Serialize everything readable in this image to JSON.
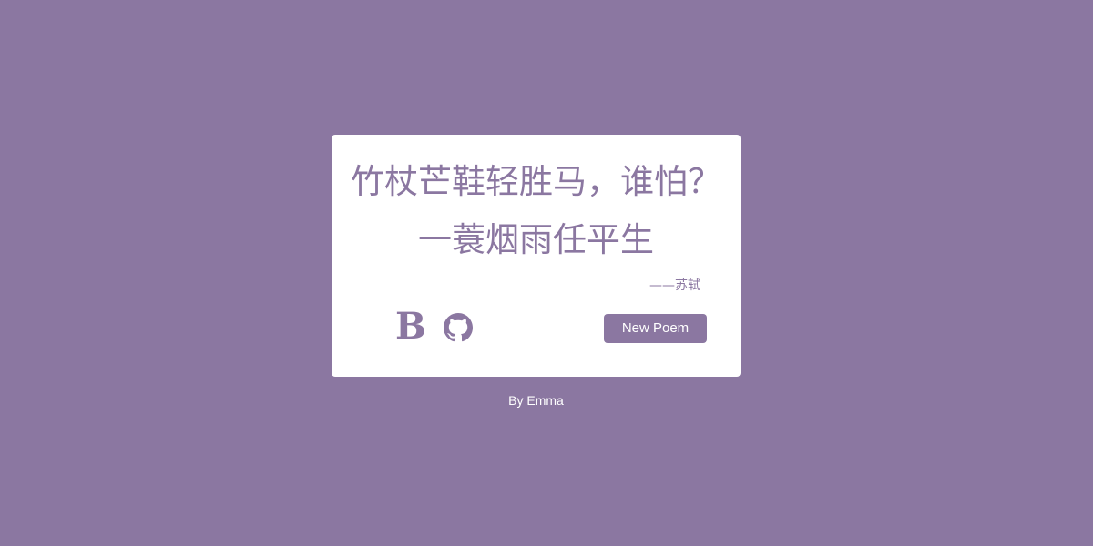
{
  "colors": {
    "background": "#8b77a1",
    "card": "#ffffff",
    "accent": "#8b77a1",
    "footer_text": "#ffffff"
  },
  "poem": {
    "line1": "竹杖芒鞋轻胜马，谁怕？",
    "line2": "一蓑烟雨任平生",
    "author": "——苏轼"
  },
  "links": {
    "blog_icon": "B",
    "blog_icon_name": "blog-b-icon",
    "github_icon_name": "github-icon"
  },
  "actions": {
    "new_poem_label": "New Poem"
  },
  "footer": {
    "credit": "By Emma"
  }
}
